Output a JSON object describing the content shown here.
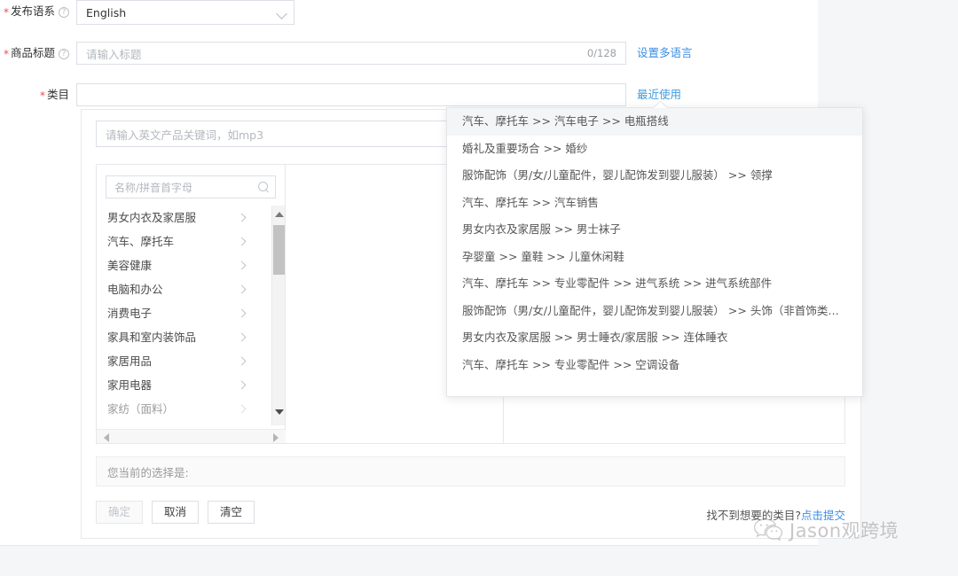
{
  "form": {
    "language_row": {
      "label": "发布语系",
      "required": true,
      "help_icon": "question-circle-icon",
      "selected_value": "English",
      "chevron_icon": "chevron-down-icon"
    },
    "title_row": {
      "label": "商品标题",
      "required": true,
      "help_icon": "question-circle-icon",
      "placeholder": "请输入标题",
      "counter": "0/128",
      "multilang_link": "设置多语言"
    },
    "category_row": {
      "label": "类目",
      "required": true,
      "value": "",
      "recent_link": "最近使用"
    }
  },
  "picker": {
    "keyword_placeholder": "请输入英文产品关键词，如mp3",
    "tree_search_placeholder": "名称/拼音首字母",
    "search_icon": "magnifier-icon",
    "tree_items": [
      {
        "label": "男女内衣及家居服",
        "arrow_icon": "chevron-right-icon"
      },
      {
        "label": "汽车、摩托车",
        "arrow_icon": "chevron-right-icon"
      },
      {
        "label": "美容健康",
        "arrow_icon": "chevron-right-icon"
      },
      {
        "label": "电脑和办公",
        "arrow_icon": "chevron-right-icon"
      },
      {
        "label": "消费电子",
        "arrow_icon": "chevron-right-icon"
      },
      {
        "label": "家具和室内装饰品",
        "arrow_icon": "chevron-right-icon"
      },
      {
        "label": "家居用品",
        "arrow_icon": "chevron-right-icon"
      },
      {
        "label": "家用电器",
        "arrow_icon": "chevron-right-icon"
      },
      {
        "label": "家纺（面料）",
        "arrow_icon": "chevron-right-icon"
      }
    ],
    "scrollbar": {
      "up_arrow_icon": "triangle-up-icon",
      "down_arrow_icon": "triangle-down-icon",
      "left_arrow_icon": "triangle-left-icon",
      "right_arrow_icon": "triangle-right-icon"
    },
    "selection_summary": "您当前的选择是:",
    "buttons": {
      "confirm": "确定",
      "cancel": "取消",
      "clear": "清空"
    },
    "not_found_text": "找不到想要的类目?",
    "not_found_link": "点击提交"
  },
  "recent_popup": {
    "items": [
      {
        "text": "汽车、摩托车 >> 汽车电子 >> 电瓶搭线",
        "active": true
      },
      {
        "text": "婚礼及重要场合 >> 婚纱",
        "active": false
      },
      {
        "text": "服饰配饰（男/女/儿童配件，婴儿配饰发到婴儿服装） >> 领撑",
        "active": false
      },
      {
        "text": "汽车、摩托车 >> 汽车销售",
        "active": false
      },
      {
        "text": "男女内衣及家居服 >> 男士袜子",
        "active": false
      },
      {
        "text": "孕婴童 >> 童鞋 >> 儿童休闲鞋",
        "active": false
      },
      {
        "text": "汽车、摩托车 >> 专业零配件 >> 进气系统 >> 进气系统部件",
        "active": false
      },
      {
        "text": "服饰配饰（男/女/儿童配件，婴儿配饰发到婴儿服装） >> 头饰（非首饰类头发饰品）",
        "active": false
      },
      {
        "text": "男女内衣及家居服 >> 男士睡衣/家居服 >> 连体睡衣",
        "active": false
      },
      {
        "text": "汽车、摩托车 >> 专业零配件 >> 空调设备",
        "active": false
      }
    ]
  },
  "watermark": {
    "icon": "wechat-logo-icon",
    "text": "Jason观跨境"
  },
  "colors": {
    "link": "#3a8ee6",
    "required": "#e94f4f",
    "border": "#dcdfe6",
    "panel_bg": "#ffffff",
    "page_bg": "#f5f6f8"
  }
}
